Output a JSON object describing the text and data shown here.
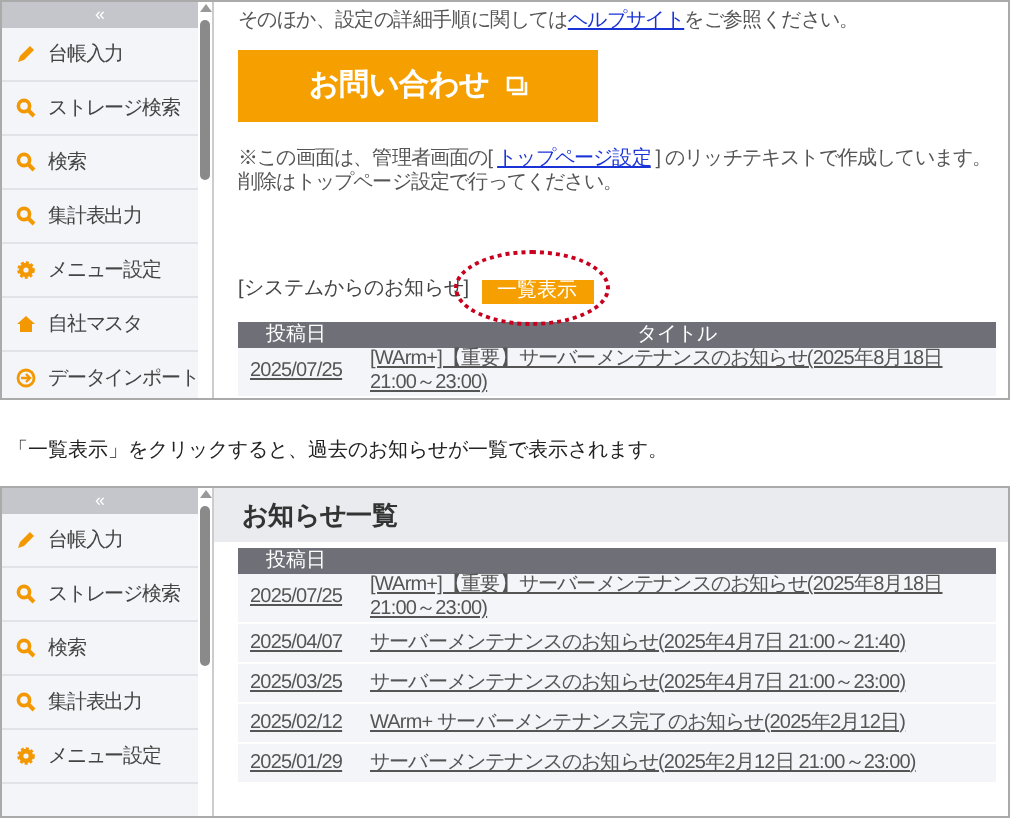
{
  "top_screen": {
    "sidebar": {
      "collapse": "«",
      "items": [
        {
          "label": "台帳入力",
          "kind": "edit"
        },
        {
          "label": "ストレージ検索",
          "kind": "search"
        },
        {
          "label": "検索",
          "kind": "search"
        },
        {
          "label": "集計表出力",
          "kind": "search"
        },
        {
          "label": "メニュー設定",
          "kind": "settings"
        },
        {
          "label": "自社マスタ",
          "kind": "home"
        },
        {
          "label": "データインポート",
          "kind": "import"
        }
      ]
    },
    "help_text": {
      "before": "そのほか、設定の詳細手順に関しては",
      "link": "ヘルプサイト",
      "after": "をご参照ください。"
    },
    "contact_button": "お問い合わせ",
    "note": {
      "before": "※この画面は、管理者画面の[ ",
      "link": "トップページ設定",
      "after": " ] のリッチテキストで作成しています。",
      "line2": "削除はトップページ設定で行ってください。"
    },
    "notices_heading": "[システムからのお知らせ]",
    "list_button": "一覧表示",
    "table": {
      "columns": [
        "投稿日",
        "タイトル"
      ],
      "rows": [
        {
          "date": "2025/07/25",
          "title": "[WArm+]【重要】サーバーメンテナンスのお知らせ(2025年8月18日 21:00～23:00)"
        }
      ]
    }
  },
  "caption": "「一覧表示」をクリックすると、過去のお知らせが一覧で表示されます。",
  "bottom_screen": {
    "sidebar": {
      "collapse": "«",
      "items": [
        {
          "label": "台帳入力",
          "kind": "edit"
        },
        {
          "label": "ストレージ検索",
          "kind": "search"
        },
        {
          "label": "検索",
          "kind": "search"
        },
        {
          "label": "集計表出力",
          "kind": "search"
        },
        {
          "label": "メニュー設定",
          "kind": "settings"
        }
      ]
    },
    "title": "お知らせ一覧",
    "table": {
      "columns": [
        "投稿日"
      ],
      "rows": [
        {
          "date": "2025/07/25",
          "title": "[WArm+]【重要】サーバーメンテナンスのお知らせ(2025年8月18日 21:00～23:00)"
        },
        {
          "date": "2025/04/07",
          "title": "サーバーメンテナンスのお知らせ(2025年4月7日 21:00～21:40)"
        },
        {
          "date": "2025/03/25",
          "title": "サーバーメンテナンスのお知らせ(2025年4月7日 21:00～23:00)"
        },
        {
          "date": "2025/02/12",
          "title": "WArm+ サーバーメンテナンス完了のお知らせ(2025年2月12日)"
        },
        {
          "date": "2025/01/29",
          "title": "サーバーメンテナンスのお知らせ(2025年2月12日 21:00～23:00)"
        }
      ]
    }
  }
}
